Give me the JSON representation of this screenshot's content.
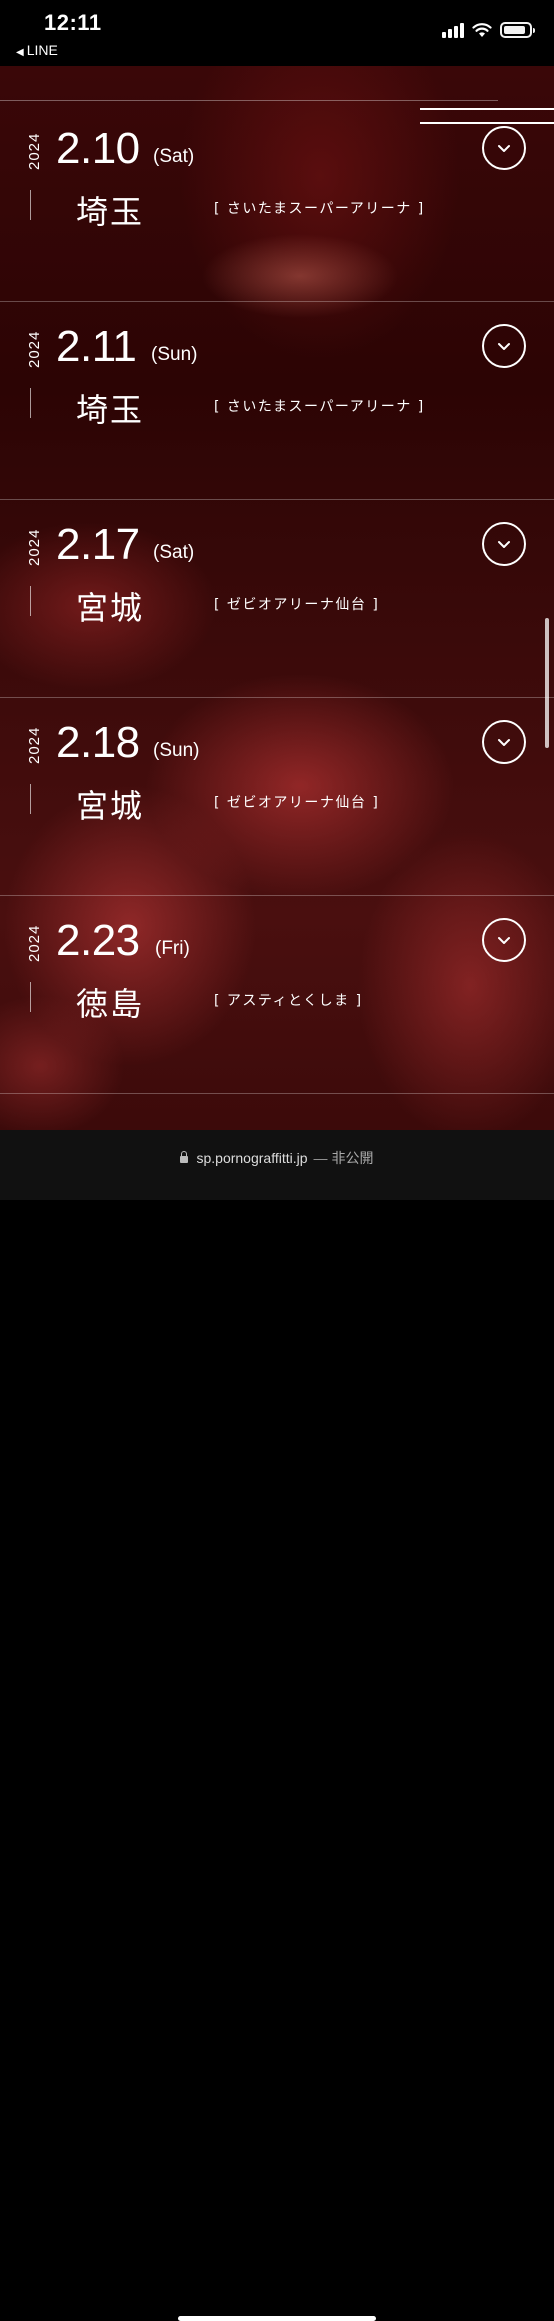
{
  "status_bar": {
    "time": "12:11",
    "back_app": "LINE",
    "icons": [
      "signal-icon",
      "wifi-icon",
      "battery-icon"
    ]
  },
  "schedule": [
    {
      "year": "2024",
      "date": "2.10",
      "day": "(Sat)",
      "city": "埼玉",
      "venue": "[ さいたまスーパーアリーナ ]"
    },
    {
      "year": "2024",
      "date": "2.11",
      "day": "(Sun)",
      "city": "埼玉",
      "venue": "[ さいたまスーパーアリーナ ]"
    },
    {
      "year": "2024",
      "date": "2.17",
      "day": "(Sat)",
      "city": "宮城",
      "venue": "[ ゼビオアリーナ仙台 ]"
    },
    {
      "year": "2024",
      "date": "2.18",
      "day": "(Sun)",
      "city": "宮城",
      "venue": "[ ゼビオアリーナ仙台 ]"
    },
    {
      "year": "2024",
      "date": "2.23",
      "day": "(Fri)",
      "city": "徳島",
      "venue": "[ アスティとくしま ]"
    }
  ],
  "address_bar": {
    "url": "sp.pornograffitti.jp",
    "separator": "—",
    "status": "非公開"
  },
  "colors": {
    "background": "#2c0404",
    "accent": "#c0392b",
    "text": "#ffffff"
  }
}
